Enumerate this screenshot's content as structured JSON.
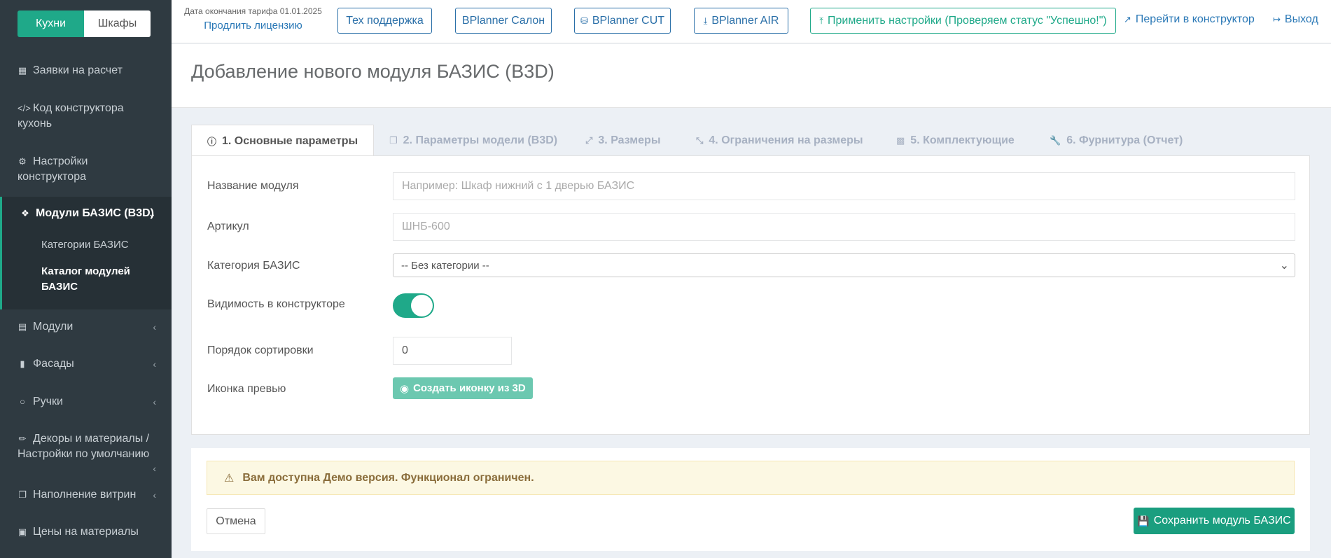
{
  "sidebar": {
    "toggle": {
      "kitchens": "Кухни",
      "cabinets": "Шкафы"
    },
    "items": [
      {
        "label": "Заявки на расчет",
        "icon": "file-icon"
      },
      {
        "label": "Код конструктора кухонь",
        "icon": "code-icon"
      },
      {
        "label": "Настройки конструктора",
        "icon": "gears-icon"
      },
      {
        "label": "Модули БАЗИС (B3D)",
        "icon": "cubes-icon"
      },
      {
        "label": "Модули",
        "icon": "archive-icon"
      },
      {
        "label": "Фасады",
        "icon": "book-icon"
      },
      {
        "label": "Ручки",
        "icon": "circle-icon"
      },
      {
        "label": "Декоры и материалы / Настройки по умолчанию",
        "icon": "brush-icon"
      },
      {
        "label": "Наполнение витрин",
        "icon": "clone-icon"
      },
      {
        "label": "Цены на материалы",
        "icon": "money-icon"
      }
    ],
    "sub_items": [
      "Категории БАЗИС",
      "Каталог модулей БАЗИС"
    ]
  },
  "topbar": {
    "license_text": "Дата окончания тарифа 01.01.2025",
    "license_link": "Продлить лицензию",
    "support": "Тех поддержка",
    "salon": "BPlanner Салон",
    "cut": "BPlanner CUT",
    "air": "BPlanner AIR",
    "apply": "Применить настройки (Проверяем статус \"Успешно!\")",
    "constructor": "Перейти в конструктор",
    "logout": "Выход"
  },
  "page": {
    "title": "Добавление нового модуля БАЗИС (B3D)"
  },
  "tabs": [
    "1. Основные параметры",
    "2. Параметры модели (B3D)",
    "3. Размеры",
    "4. Ограничения на размеры",
    "5. Комплектующие",
    "6. Фурнитура (Отчет)"
  ],
  "form": {
    "name_label": "Название модуля",
    "name_placeholder": "Например: Шкаф нижний с 1 дверью БАЗИС",
    "sku_label": "Артикул",
    "sku_placeholder": "ШНБ-600",
    "category_label": "Категория БАЗИС",
    "category_value": "-- Без категории --",
    "visibility_label": "Видимость в конструкторе",
    "visibility_on": true,
    "sort_label": "Порядок сортировки",
    "sort_value": "0",
    "preview_label": "Иконка превью",
    "preview_button": "Создать иконку из 3D"
  },
  "footer": {
    "alert": "Вам доступна Демо версия. Функционал ограничен.",
    "cancel": "Отмена",
    "save": "Сохранить модуль БАЗИС"
  },
  "colors": {
    "accent": "#1fa989",
    "sidebar": "#2f3a41",
    "link": "#2a78b6"
  }
}
